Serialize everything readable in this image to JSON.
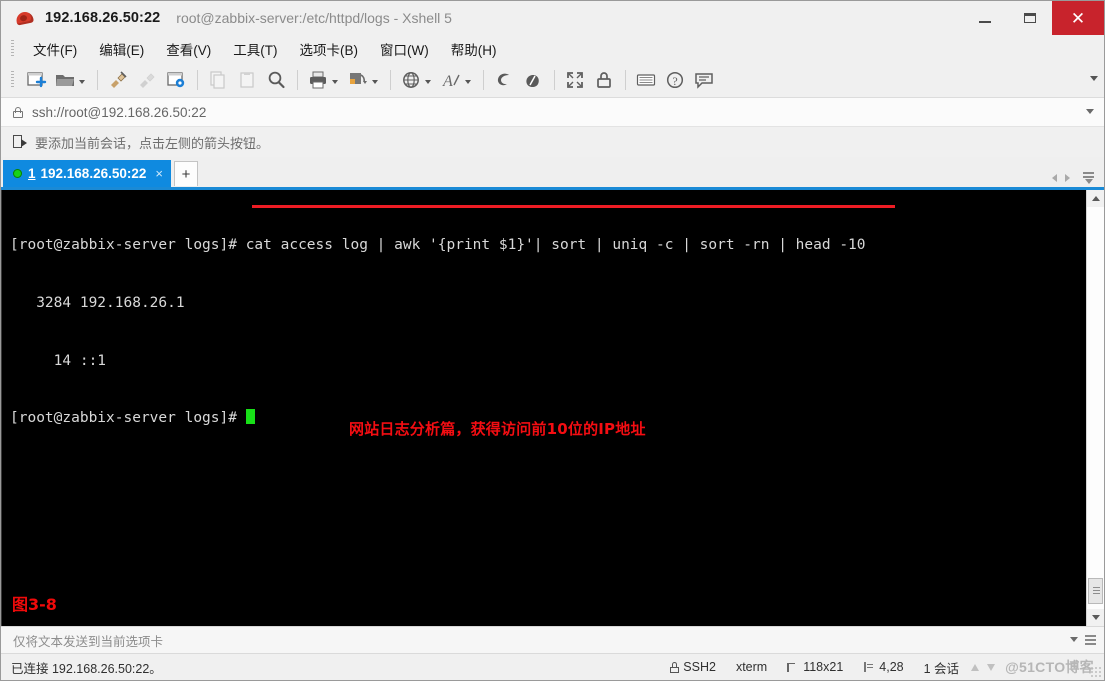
{
  "window": {
    "host_title": "192.168.26.50:22",
    "doc_title": "root@zabbix-server:/etc/httpd/logs - Xshell 5",
    "app_icon": "xshell-icon",
    "minimize_label": "–",
    "maximize_label": "□",
    "close_label": "✕"
  },
  "menubar": {
    "items": [
      {
        "label": "文件(F)",
        "name": "menu-file"
      },
      {
        "label": "编辑(E)",
        "name": "menu-edit"
      },
      {
        "label": "查看(V)",
        "name": "menu-view"
      },
      {
        "label": "工具(T)",
        "name": "menu-tools"
      },
      {
        "label": "选项卡(B)",
        "name": "menu-tabs"
      },
      {
        "label": "窗口(W)",
        "name": "menu-window"
      },
      {
        "label": "帮助(H)",
        "name": "menu-help"
      }
    ]
  },
  "toolbar": {
    "icons": [
      "new-session-icon",
      "open-folder-icon",
      "folder-dropdown-caret",
      "separator",
      "connect-plug-icon",
      "disconnect-plug-icon",
      "session-properties-icon",
      "separator",
      "copy-icon",
      "paste-icon",
      "find-icon",
      "separator",
      "print-icon",
      "print-dropdown-caret",
      "layout-icon",
      "layout-dropdown-caret",
      "separator",
      "globe-icon",
      "globe-dropdown-caret",
      "font-icon",
      "font-dropdown-caret",
      "separator",
      "xftp-icon",
      "xagent-icon",
      "separator",
      "fullscreen-icon",
      "lock-icon",
      "separator",
      "keyboard-icon",
      "help-icon",
      "chat-icon"
    ],
    "overflow_label": "▾"
  },
  "address_bar": {
    "lock_icon": "lock-icon",
    "value": "ssh://root@192.168.26.50:22",
    "placeholder": "ssh://root@192.168.26.50:22",
    "dropdown_icon": "chevron-down-icon"
  },
  "hint_bar": {
    "icon": "add-session-arrow-icon",
    "text": "要添加当前会话，点击左侧的箭头按钮。"
  },
  "tabs": {
    "items": [
      {
        "status_icon": "connected-dot-icon",
        "index": "1",
        "label": "192.168.26.50:22",
        "close_label": "×",
        "active": true
      }
    ],
    "add_label": "+",
    "nav_prev_icon": "chevron-left-icon",
    "nav_next_icon": "chevron-right-icon",
    "tab_list_icon": "tab-list-menu-icon"
  },
  "terminal": {
    "prompt": "[root@zabbix-server logs]# ",
    "command": "cat access log | awk '{print $1}'| sort | uniq -c | sort -rn | head -10",
    "output_lines": [
      "   3284 192.168.26.1",
      "     14 ::1"
    ],
    "prompt2": "[root@zabbix-server logs]# ",
    "cursor": "block-cursor",
    "annotation": "网站日志分析篇，获得访问前10位的IP地址",
    "figure_caption": "图3-8",
    "colors": {
      "background": "#000000",
      "text": "#d8d8d8",
      "annotation": "#f40d12",
      "underline": "#ed1c24",
      "cursor": "#18e018"
    }
  },
  "scrollbar": {
    "up_icon": "scroll-up-arrow-icon",
    "down_icon": "scroll-down-arrow-icon",
    "thumb": "scroll-thumb"
  },
  "send_bar": {
    "text": "仅将文本发送到当前选项卡",
    "dropdown_icon": "chevron-down-icon",
    "menu_icon": "send-options-menu-icon"
  },
  "status_bar": {
    "connection": "已连接 192.168.26.50:22。",
    "protocol": "SSH2",
    "terminal_type": "xterm",
    "size": "118x21",
    "cursor_position": "4,28",
    "sessions": "1 会话",
    "upload_icon": "upload-arrow-icon",
    "download_icon": "download-arrow-icon",
    "watermark": "@51CTO博客"
  }
}
